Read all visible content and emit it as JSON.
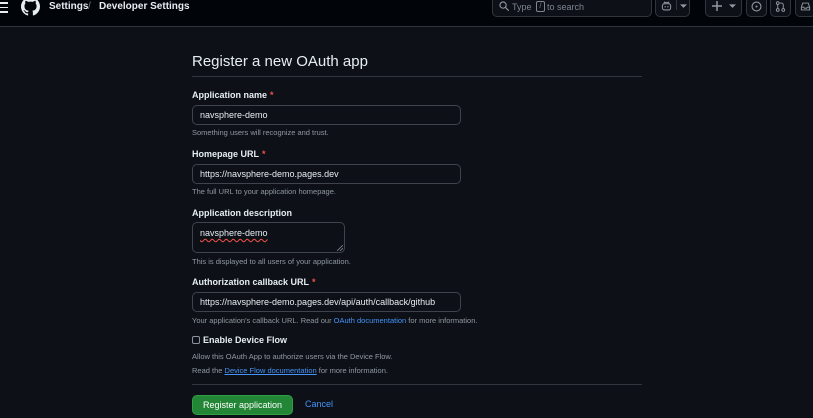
{
  "header": {
    "breadcrumb": [
      "Settings",
      "/",
      "Developer Settings"
    ],
    "search": {
      "prefix": "Type",
      "key": "/",
      "suffix": "to search"
    },
    "icons": [
      "menu-icon",
      "github-logo-icon",
      "search-icon",
      "copilot-icon",
      "chevron-down-icon",
      "plus-icon",
      "chevron-down-icon",
      "issues-icon",
      "pull-request-icon",
      "inbox-icon"
    ]
  },
  "form": {
    "title": "Register a new OAuth app",
    "app_name": {
      "label": "Application name",
      "required": "*",
      "value": "navsphere-demo",
      "hint": "Something users will recognize and trust."
    },
    "homepage_url": {
      "label": "Homepage URL",
      "required": "*",
      "value": "https://navsphere-demo.pages.dev",
      "hint": "The full URL to your application homepage."
    },
    "description": {
      "label": "Application description",
      "value": "navsphere-demo",
      "hint": "This is displayed to all users of your application."
    },
    "callback_url": {
      "label": "Authorization callback URL",
      "required": "*",
      "value": "https://navsphere-demo.pages.dev/api/auth/callback/github",
      "hint_prefix": "Your application's callback URL. Read our ",
      "hint_link": "OAuth documentation",
      "hint_suffix": " for more information."
    },
    "device_flow": {
      "label": "Enable Device Flow",
      "checked": false,
      "hint1": "Allow this OAuth App to authorize users via the Device Flow.",
      "hint2_prefix": "Read the ",
      "hint2_link": "Device Flow documentation",
      "hint2_suffix": " for more information."
    },
    "submit_label": "Register application",
    "cancel_label": "Cancel"
  },
  "colors": {
    "background": "#0d1117",
    "header_bg": "#010409",
    "primary_button": "#238636",
    "link": "#4493f8",
    "required": "#f85149"
  }
}
